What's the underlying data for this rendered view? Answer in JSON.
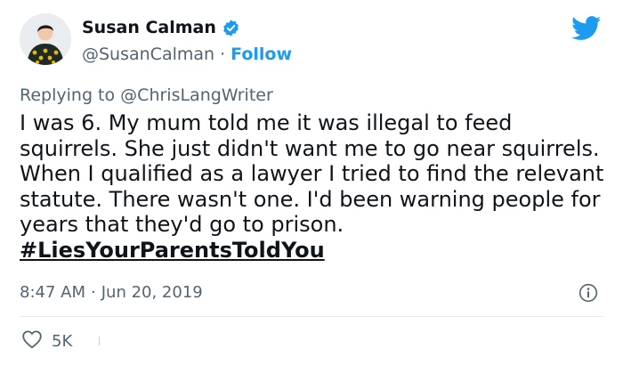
{
  "author": {
    "name": "Susan Calman",
    "handle": "@SusanCalman",
    "separator": "·",
    "follow_label": "Follow",
    "verified": true
  },
  "reply": {
    "prefix": "Replying to",
    "handle": "@ChrisLangWriter"
  },
  "tweet": {
    "text": "I was 6. My mum told me it was illegal to feed squirrels. She just didn't want me to go near squirrels. When I qualified as a lawyer I tried to find the relevant statute. There wasn't one. I'd been warning people for years that they'd go to prison. ",
    "hashtag": "#LiesYourParentsToldYou"
  },
  "meta": {
    "time": "8:47 AM",
    "separator": "·",
    "date": "Jun 20, 2019"
  },
  "actions": {
    "like_count": "5K"
  },
  "colors": {
    "brand": "#1d9bf0",
    "text": "#0f1419",
    "muted": "#536471"
  },
  "icons": {
    "logo": "twitter-bird-icon",
    "verified": "verified-badge-icon",
    "info": "info-icon",
    "like": "heart-icon"
  }
}
